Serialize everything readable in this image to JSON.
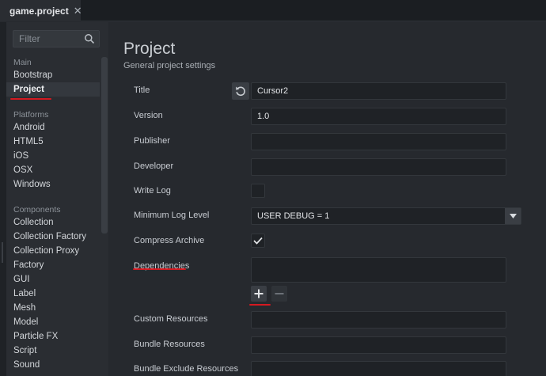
{
  "tab": {
    "label": "game.project",
    "close": "✕"
  },
  "filter": {
    "placeholder": "Filter"
  },
  "sidebar": {
    "sections": [
      {
        "title": "Main",
        "items": [
          "Bootstrap",
          "Project"
        ]
      },
      {
        "title": "Platforms",
        "items": [
          "Android",
          "HTML5",
          "iOS",
          "OSX",
          "Windows"
        ]
      },
      {
        "title": "Components",
        "items": [
          "Collection",
          "Collection Factory",
          "Collection Proxy",
          "Factory",
          "GUI",
          "Label",
          "Mesh",
          "Model",
          "Particle FX",
          "Script",
          "Sound"
        ]
      }
    ],
    "active_item": "Project"
  },
  "main": {
    "title": "Project",
    "subtitle": "General project settings",
    "fields": {
      "title": {
        "label": "Title",
        "value": "Cursor2"
      },
      "version": {
        "label": "Version",
        "value": "1.0"
      },
      "publisher": {
        "label": "Publisher",
        "value": ""
      },
      "developer": {
        "label": "Developer",
        "value": ""
      },
      "write_log": {
        "label": "Write Log",
        "checked": false
      },
      "min_log_level": {
        "label": "Minimum Log Level",
        "value": "USER DEBUG = 1"
      },
      "compress_archive": {
        "label": "Compress Archive",
        "checked": true
      },
      "dependencies": {
        "label": "Dependencies",
        "value": ""
      },
      "custom_resources": {
        "label": "Custom Resources",
        "value": ""
      },
      "bundle_resources": {
        "label": "Bundle Resources",
        "value": ""
      },
      "bundle_exclude_resources": {
        "label": "Bundle Exclude Resources",
        "value": ""
      }
    }
  },
  "colors": {
    "background": "#26292e",
    "sidebar": "#2a2d32",
    "annotation_red": "#d41920",
    "defold_green": "#2bb34b"
  }
}
